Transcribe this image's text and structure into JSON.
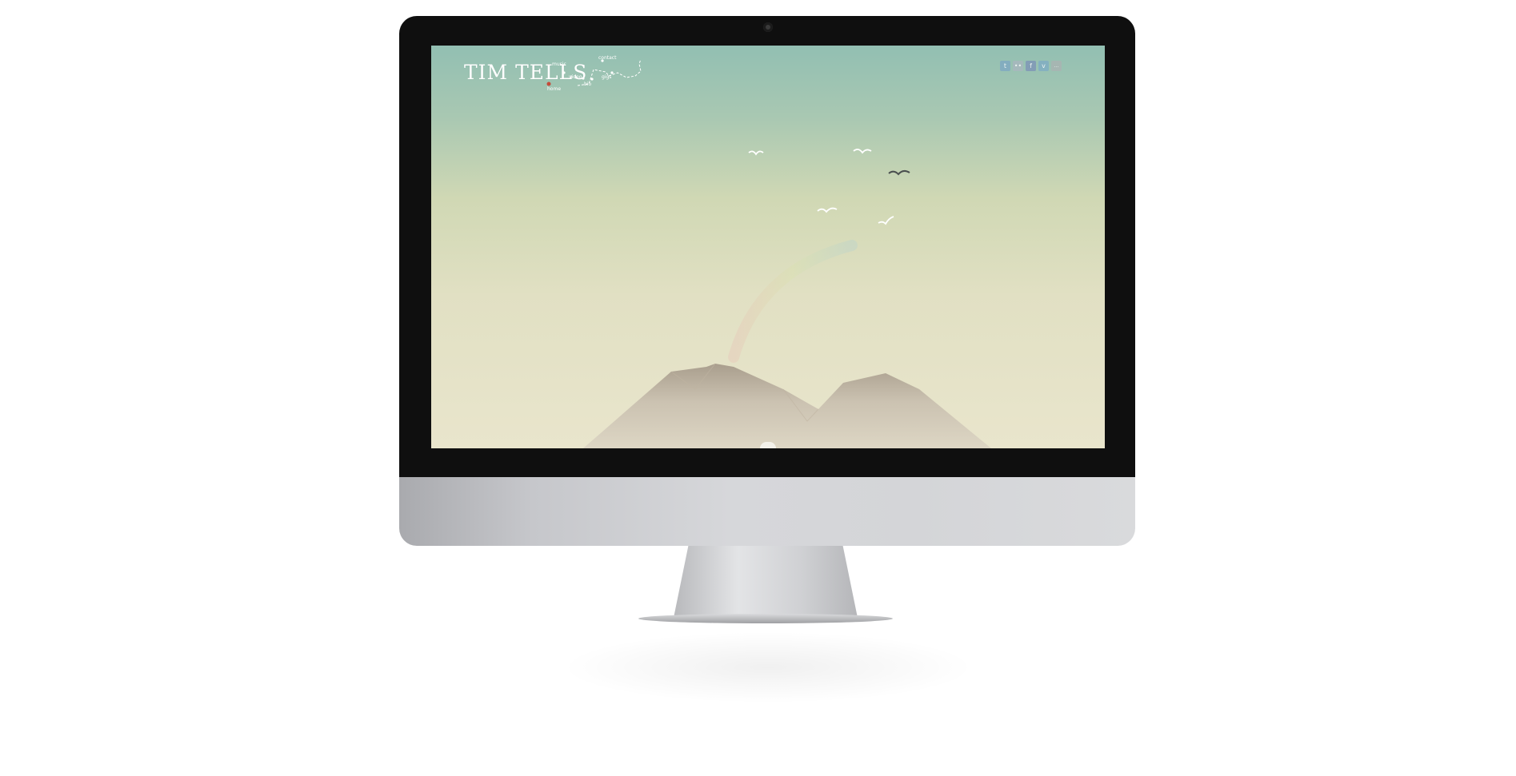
{
  "site": {
    "logo_text": "TIM TELLS",
    "nav": {
      "home": "home",
      "music": "music",
      "video": "video",
      "bio": "bio",
      "gigs": "gigs",
      "contact": "contact"
    },
    "social": {
      "twitter": "t",
      "flickr": "••",
      "facebook": "f",
      "vimeo": "v",
      "extra": "…"
    }
  },
  "colors": {
    "sky_top": "#92bfb2",
    "sky_bottom": "#e9e5cc",
    "mountain": "#c8c0b0",
    "current_page_marker": "#c44b3a"
  }
}
